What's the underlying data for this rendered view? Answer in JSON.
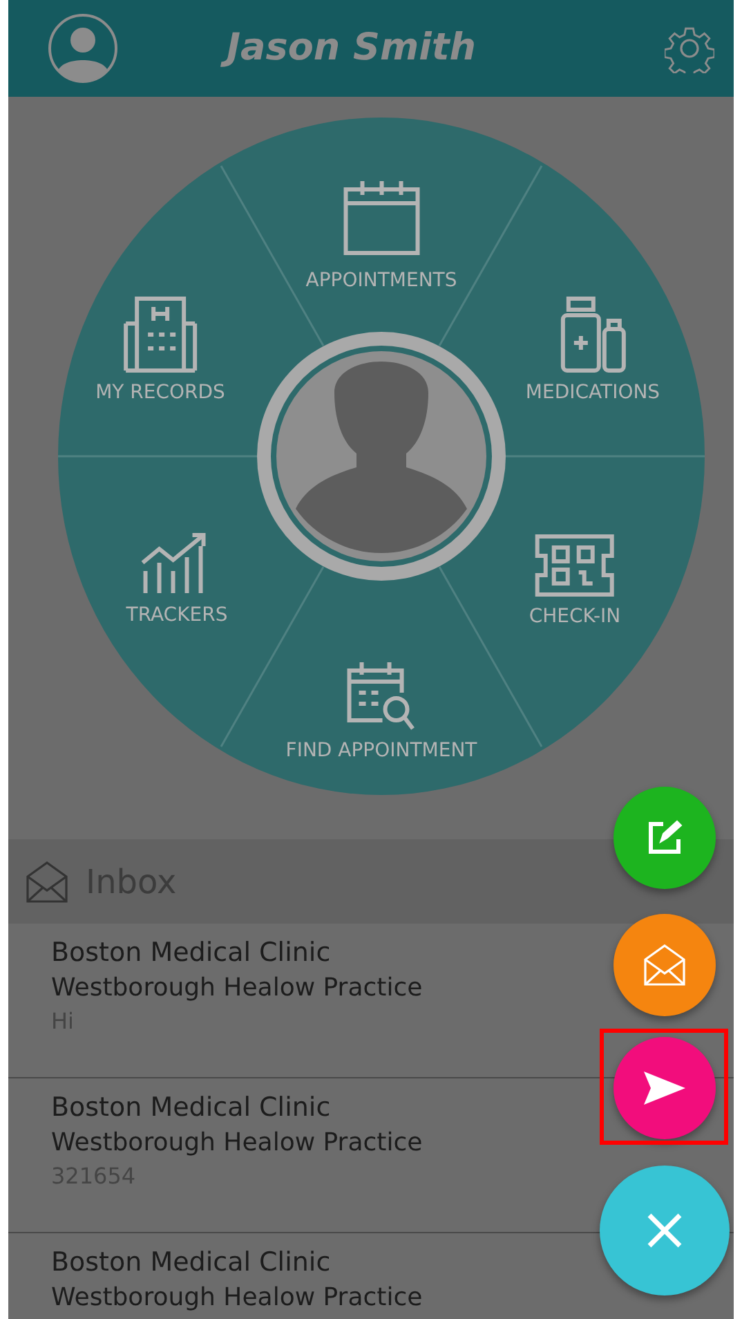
{
  "header": {
    "title": "Jason Smith"
  },
  "menu": [
    {
      "label": "APPOINTMENTS"
    },
    {
      "label": "MEDICATIONS"
    },
    {
      "label": "CHECK-IN"
    },
    {
      "label": "FIND APPOINTMENT"
    },
    {
      "label": "TRACKERS"
    },
    {
      "label": "MY RECORDS"
    }
  ],
  "inbox": {
    "title": "Inbox",
    "messages": [
      {
        "sender": "Boston Medical Clinic",
        "practice": "Westborough Healow Practice",
        "preview": "Hi"
      },
      {
        "sender": "Boston Medical Clinic",
        "practice": "Westborough Healow Practice",
        "preview": "321654"
      },
      {
        "sender": "Boston Medical Clinic",
        "practice": "Westborough Healow Practice"
      }
    ]
  },
  "fabs": [
    {
      "color": "#1db41f",
      "highlighted": false
    },
    {
      "color": "#f5850f",
      "highlighted": false
    },
    {
      "color": "#f20d7c",
      "highlighted": true
    },
    {
      "color": "#37c4d4",
      "highlighted": false
    }
  ]
}
